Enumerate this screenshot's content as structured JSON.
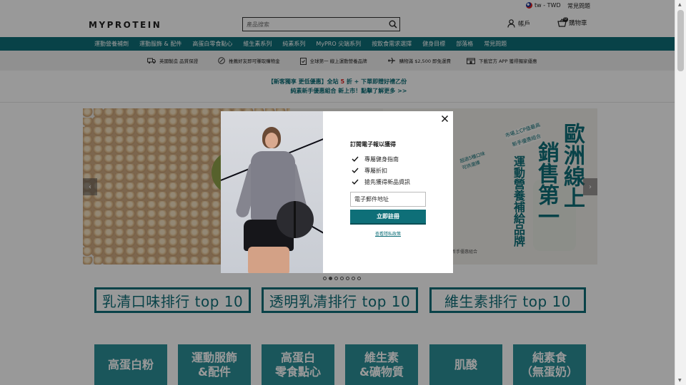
{
  "utility": {
    "locale": "tw - TWD",
    "faq": "常見問題"
  },
  "header": {
    "logo": "MYPROTEIN",
    "search_placeholder": "產品搜索",
    "account_label": "帳戶",
    "cart_label": "購物車",
    "cart_count": "0"
  },
  "nav": {
    "items": [
      "運動營養補劑",
      "運動服飾 & 配件",
      "高蛋白零食點心",
      "維生素系列",
      "純素系列",
      "MyPRO 尖端系列",
      "按飲食需求選擇",
      "健身目標",
      "部落格",
      "常見問題"
    ]
  },
  "usp": {
    "items": [
      "英國製造 品質保證",
      "推薦好友即可賺取購物金",
      "全球第一 線上運動營養品牌",
      "購物滿 $2,500 即免運費",
      "下載官方 APP 獲得獨家優惠"
    ]
  },
  "promo": {
    "line1_a": "【新客獨享 更低優惠】全站",
    "line1_num": "5",
    "line1_b": "折 + 下單即贈好禮乙份",
    "line2": "純素新手優惠組合 新上市！點擊了解更多 >>"
  },
  "hero": {
    "tag1": "市場上CP值最高",
    "tag2": "新手優惠組合",
    "big_col1": "歐洲線上",
    "big_col2": "銷售第一",
    "small_col": "運動營養補給品牌",
    "badge_text": "超過5種口味可供選擇",
    "caption": "新手優惠組合"
  },
  "carousel": {
    "total_slides": 7,
    "active_index": 1
  },
  "rankings": [
    "乳清口味排行 top 10",
    "透明乳清排行 top 10",
    "維生素排行 top 10"
  ],
  "categories": [
    {
      "line1": "高蛋白粉",
      "line2": ""
    },
    {
      "line1": "運動服飾",
      "line2": "&配件"
    },
    {
      "line1": "高蛋白",
      "line2": "零食點心"
    },
    {
      "line1": "維生素",
      "line2": "&礦物質"
    },
    {
      "line1": "肌酸",
      "line2": ""
    },
    {
      "line1": "純素食",
      "line2": "（無蛋奶）"
    }
  ],
  "modal": {
    "title": "訂閱電子報以獲得",
    "benefits": [
      "專屬健身指南",
      "專屬折扣",
      "搶先獲得新品資訊"
    ],
    "email_placeholder": "電子郵件地址",
    "submit_label": "立即註冊",
    "privacy_link": "查看隱私政策"
  },
  "colors": {
    "brand": "#0e6f78",
    "tile": "#2c8f98",
    "promo_red": "#dd2222"
  }
}
